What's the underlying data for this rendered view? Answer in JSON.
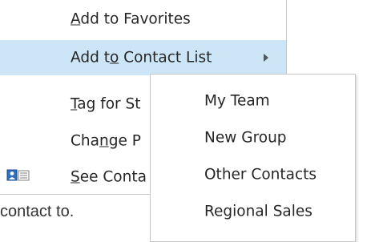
{
  "background": {
    "text": "contact to."
  },
  "context_menu": {
    "items": [
      {
        "before": "",
        "accel": "A",
        "after": "dd to Favorites"
      },
      {
        "before": "Add t",
        "accel": "o",
        "after": " Contact List"
      },
      {
        "before": "",
        "accel": "T",
        "after": "ag for St"
      },
      {
        "before": "Cha",
        "accel": "n",
        "after": "ge P"
      },
      {
        "before": "",
        "accel": "S",
        "after": "ee Conta"
      }
    ],
    "highlighted_index": 1,
    "highlight_color": "#cde6f7",
    "submenu_arrow_icon": "triangle-right-icon",
    "contact_card_icon": "contact-card-icon"
  },
  "submenu": {
    "items": [
      {
        "label": "My Team"
      },
      {
        "label": "New Group"
      },
      {
        "label": "Other Contacts"
      },
      {
        "label": "Regional Sales"
      }
    ]
  }
}
